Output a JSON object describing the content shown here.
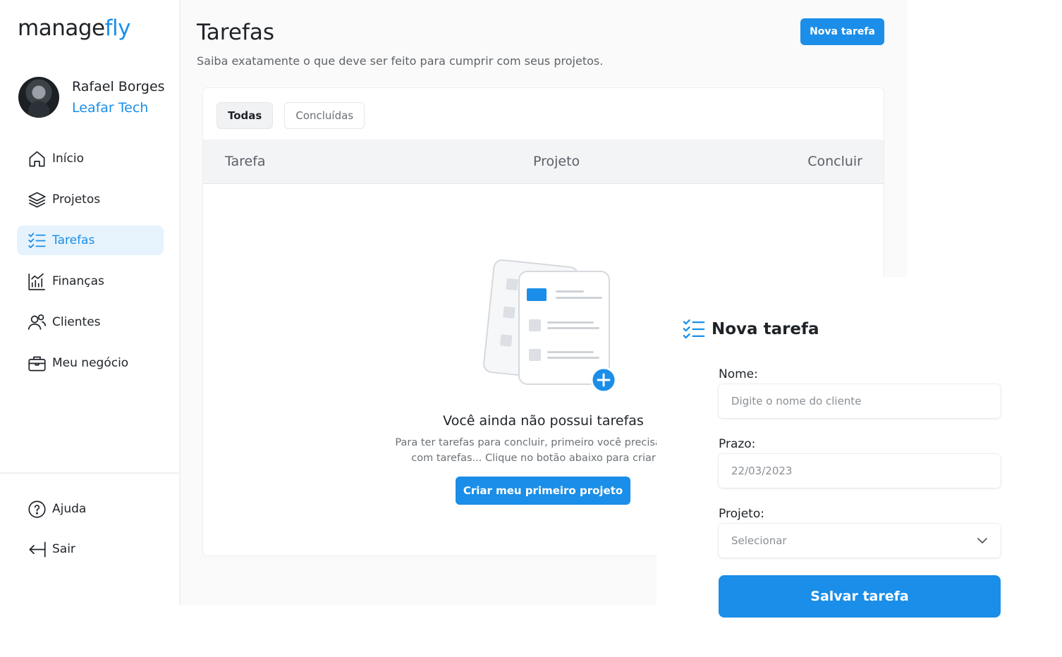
{
  "app": {
    "logo_main": "manage",
    "logo_accent": "fly",
    "accent_color": "#1a8ee8"
  },
  "user": {
    "name": "Rafael Borges",
    "company": "Leafar Tech"
  },
  "sidebar": {
    "items": [
      {
        "label": "Início",
        "icon": "home-icon",
        "active": false
      },
      {
        "label": "Projetos",
        "icon": "layers-icon",
        "active": false
      },
      {
        "label": "Tarefas",
        "icon": "checklist-icon",
        "active": true
      },
      {
        "label": "Finanças",
        "icon": "chart-icon",
        "active": false
      },
      {
        "label": "Clientes",
        "icon": "users-icon",
        "active": false
      },
      {
        "label": "Meu negócio",
        "icon": "briefcase-icon",
        "active": false
      }
    ],
    "bottom": [
      {
        "label": "Ajuda",
        "icon": "help-icon"
      },
      {
        "label": "Sair",
        "icon": "logout-icon"
      }
    ]
  },
  "page": {
    "title": "Tarefas",
    "subtitle": "Saiba exatamente o que deve ser feito para cumprir com seus projetos.",
    "new_task_label": "Nova tarefa"
  },
  "tabs": [
    {
      "label": "Todas",
      "active": true
    },
    {
      "label": "Concluídas",
      "active": false
    }
  ],
  "table": {
    "columns": [
      "Tarefa",
      "Projeto",
      "Concluir"
    ]
  },
  "empty_state": {
    "title": "Você ainda não possui tarefas",
    "description_line1": "Para ter tarefas para concluir, primeiro você precisa ter al",
    "description_line2": "com tarefas... Clique no botão abaixo para criar um",
    "button_label": "Criar meu primeiro projeto"
  },
  "form": {
    "title": "Nova tarefa",
    "name_label": "Nome:",
    "name_placeholder": "Digite o nome do cliente",
    "deadline_label": "Prazo:",
    "deadline_value": "22/03/2023",
    "project_label": "Projeto:",
    "project_value": "Selecionar",
    "submit_label": "Salvar tarefa"
  }
}
